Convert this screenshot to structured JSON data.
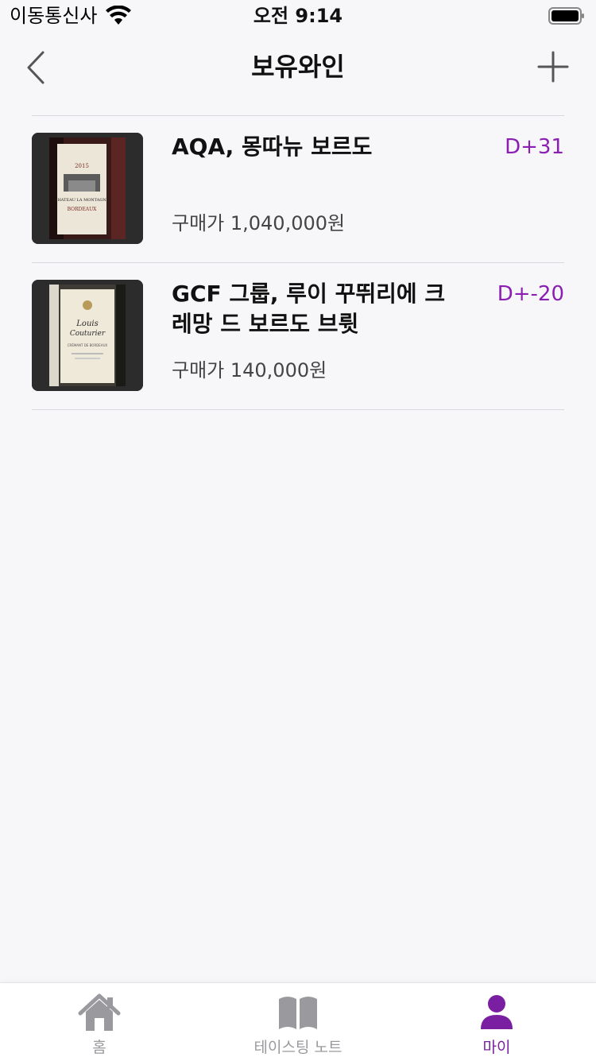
{
  "status_bar": {
    "carrier": "이동통신사",
    "time": "오전 9:14"
  },
  "nav": {
    "title": "보유와인",
    "back_icon": "chevron-left-icon",
    "add_icon": "plus-icon"
  },
  "wines": [
    {
      "name": "AQA, 몽따뉴 보르도",
      "price": "구매가 1,040,000원",
      "dday": "D+31",
      "label_text": [
        "2015",
        "CHATEAU LA MONTAGNE",
        "BORDEAUX"
      ]
    },
    {
      "name": "GCF 그룹, 루이 꾸뛰리에 크레망 드 보르도 브륏",
      "price": "구매가 140,000원",
      "dday": "D+-20",
      "label_text": [
        "Louis",
        "Couturier",
        "CRÉMANT DE BORDEAUX"
      ]
    }
  ],
  "tabs": [
    {
      "label": "홈",
      "icon": "home-icon",
      "active": false
    },
    {
      "label": "테이스팅 노트",
      "icon": "book-icon",
      "active": false
    },
    {
      "label": "마이",
      "icon": "person-icon",
      "active": true
    }
  ],
  "colors": {
    "accent": "#7b1fa2",
    "dday": "#8a1fb2",
    "inactive_tab": "#9a9a9e",
    "background": "#f7f7f9",
    "separator": "#d8d8dc"
  }
}
